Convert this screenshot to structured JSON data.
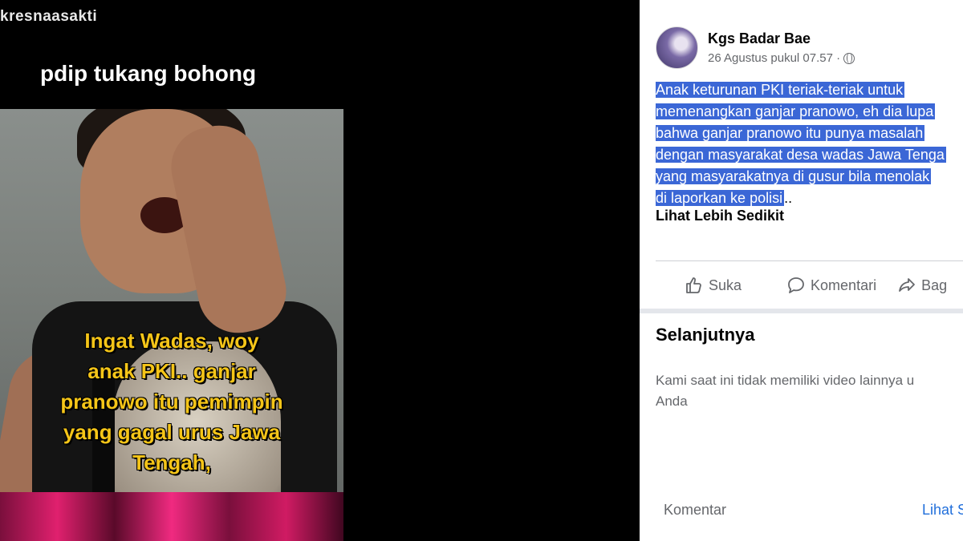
{
  "video": {
    "watermark": "kresnaasakti",
    "caption": "pdip tukang bohong",
    "overlay_lines": [
      "Ingat Wadas, woy",
      "anak PKI.. ganjar",
      "pranowo itu pemimpin",
      "yang gagal urus Jawa",
      "Tengah,"
    ]
  },
  "post": {
    "author": "Kgs Badar Bae",
    "timestamp": "26 Agustus pukul 07.57 ·",
    "privacy_icon": "globe-icon",
    "text_lines": [
      "Anak keturunan PKI teriak-teriak untuk",
      "memenangkan ganjar pranowo, eh dia lupa",
      "bahwa ganjar pranowo itu punya masalah",
      "dengan masyarakat desa wadas Jawa Tenga",
      "yang masyarakatnya di gusur bila menolak",
      "di laporkan ke polisi"
    ],
    "text_tail": "..",
    "see_less": "Lihat Lebih Sedikit",
    "highlight_color": "#3b67d6"
  },
  "actions": {
    "like": "Suka",
    "comment": "Komentari",
    "share": "Bag"
  },
  "next": {
    "title": "Selanjutnya",
    "message_lines": [
      "Kami saat ini tidak memiliki video lainnya u",
      "Anda"
    ]
  },
  "footer": {
    "comment_label": "Komentar",
    "see_more": "Lihat S"
  }
}
